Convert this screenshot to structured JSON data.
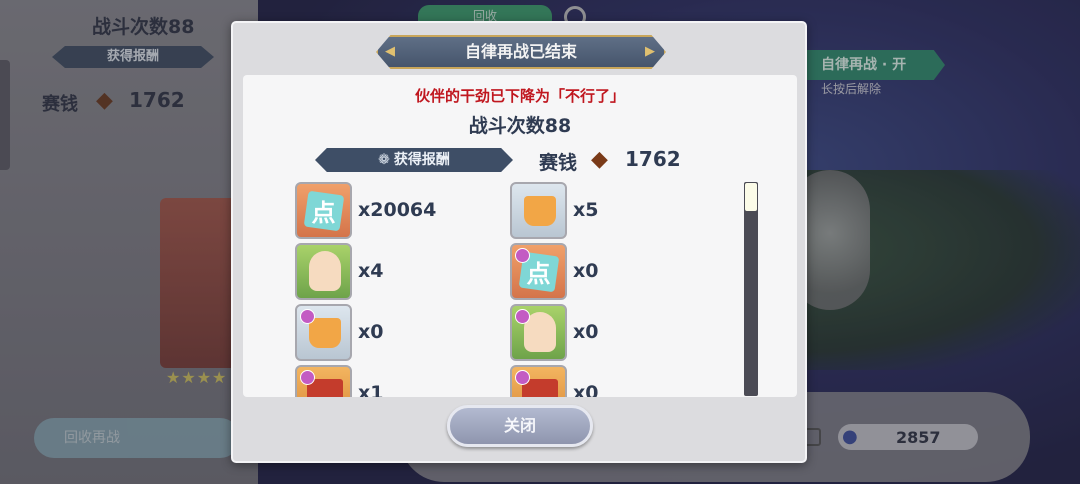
{
  "background": {
    "battle_count": "战斗次数88",
    "reward_ribbon": "获得报酬",
    "money_label": "赛钱",
    "money_value": "1762",
    "top_tab": "回收",
    "auto_battle": "自律再战 · 开",
    "auto_hint": "长按后解除",
    "retreat": "回收再战",
    "stamina_value": "2857"
  },
  "modal": {
    "title": "自律再战已结束",
    "warning": "伙伴的干劲已下降为「不行了」",
    "battle_count": "战斗次数88",
    "reward_label": "获得报酬",
    "money_label": "赛钱",
    "money_value": "1762",
    "close_label": "关闭",
    "items": [
      {
        "icon": "point-item-icon",
        "count": "x20064"
      },
      {
        "icon": "pudding-item-icon",
        "count": "x5"
      },
      {
        "icon": "character-item-icon",
        "count": "x4"
      },
      {
        "icon": "point-item-icon",
        "count": "x0"
      },
      {
        "icon": "pudding-item-icon",
        "count": "x0"
      },
      {
        "icon": "character-item-icon",
        "count": "x0"
      },
      {
        "icon": "book-item-icon",
        "count": "x1"
      },
      {
        "icon": "book-item-icon",
        "count": "x0"
      }
    ]
  },
  "colors": {
    "warning": "#c0171f",
    "ribbon": "#3e4e66",
    "text": "#2f3b52"
  }
}
